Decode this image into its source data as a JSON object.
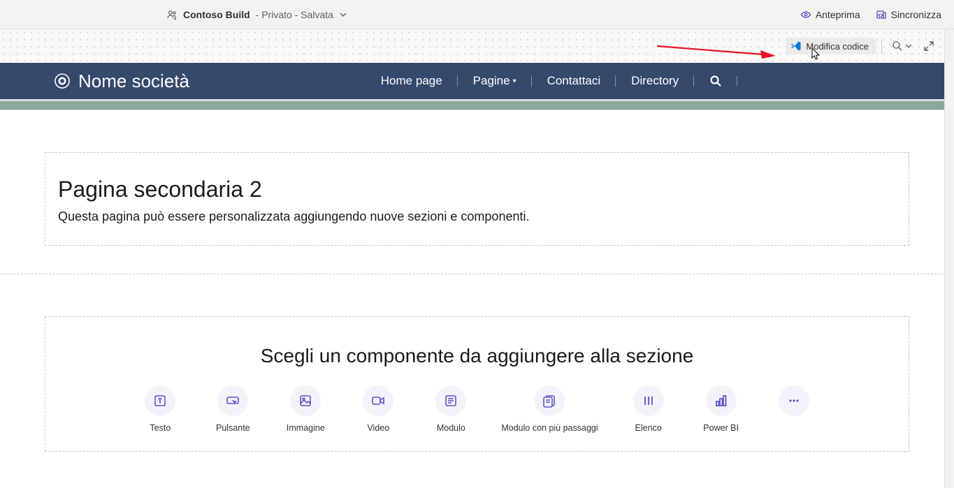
{
  "topbar": {
    "app_name": "Contoso Build",
    "app_meta": " - Privato - Salvata",
    "preview_label": "Anteprima",
    "sync_label": "Sincronizza"
  },
  "toolbar": {
    "edit_code_label": "Modifica codice"
  },
  "site": {
    "brand": "Nome società",
    "nav": {
      "home": "Home page",
      "pages": "Pagine",
      "contact": "Contattaci",
      "directory": "Directory"
    }
  },
  "page": {
    "title": "Pagina secondaria 2",
    "subtitle": "Questa pagina può essere personalizzata aggiungendo nuove sezioni e componenti."
  },
  "picker": {
    "heading": "Scegli un componente da aggiungere alla sezione",
    "items": {
      "text": "Testo",
      "button": "Pulsante",
      "image": "Immagine",
      "video": "Video",
      "form": "Modulo",
      "multistep": "Modulo con più passaggi",
      "list": "Elenco",
      "powerbi": "Power BI",
      "more": "..."
    }
  }
}
